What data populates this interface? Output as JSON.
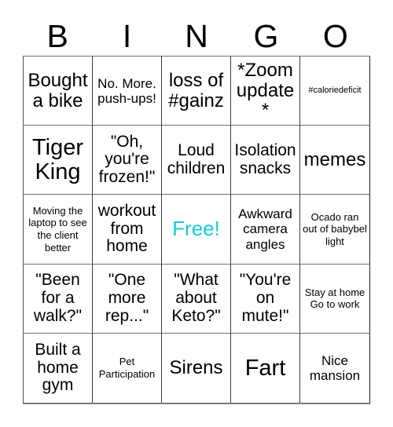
{
  "header": {
    "letters": [
      "B",
      "I",
      "N",
      "G",
      "O"
    ]
  },
  "grid": {
    "rows": 5,
    "columns": 5,
    "free_space_color": "#1ac7da",
    "border_color": "#3c3c3c",
    "background_color": "#ffffff",
    "text_color": "#000000",
    "cells": [
      {
        "text": "Bought a bike",
        "size": "xl",
        "free": false
      },
      {
        "text": "No. More. push-ups!",
        "size": "md",
        "free": false
      },
      {
        "text": "loss of #gainz",
        "size": "xl",
        "free": false
      },
      {
        "text": "*Zoom update*",
        "size": "xl",
        "free": false
      },
      {
        "text": "#caloriedeficit",
        "size": "xs",
        "free": false
      },
      {
        "text": "Tiger King",
        "size": "xxl",
        "free": false
      },
      {
        "text": "\"Oh, you're frozen!\"",
        "size": "lg",
        "free": false
      },
      {
        "text": "Loud children",
        "size": "lg",
        "free": false
      },
      {
        "text": "Isolation snacks",
        "size": "lg",
        "free": false
      },
      {
        "text": "memes",
        "size": "xl",
        "free": false
      },
      {
        "text": "Moving the laptop to see the client better",
        "size": "sm",
        "free": false
      },
      {
        "text": "workout from home",
        "size": "lg",
        "free": false
      },
      {
        "text": "Free!",
        "size": "xl",
        "free": true
      },
      {
        "text": "Awkward camera angles",
        "size": "md",
        "free": false
      },
      {
        "text": "Ocado ran out of babybel light",
        "size": "sm",
        "free": false
      },
      {
        "text": "\"Been for a walk?\"",
        "size": "lg",
        "free": false
      },
      {
        "text": "\"One more rep...\"",
        "size": "lg",
        "free": false
      },
      {
        "text": "\"What about Keto?\"",
        "size": "lg",
        "free": false
      },
      {
        "text": "\"You're on mute!\"",
        "size": "lg",
        "free": false
      },
      {
        "text": "Stay at home Go to work",
        "size": "sm",
        "free": false
      },
      {
        "text": "Built a home gym",
        "size": "lg",
        "free": false
      },
      {
        "text": "Pet Participation",
        "size": "sm",
        "free": false
      },
      {
        "text": "Sirens",
        "size": "xl",
        "free": false
      },
      {
        "text": "Fart",
        "size": "xxl",
        "free": false
      },
      {
        "text": "Nice mansion",
        "size": "md",
        "free": false
      }
    ]
  }
}
